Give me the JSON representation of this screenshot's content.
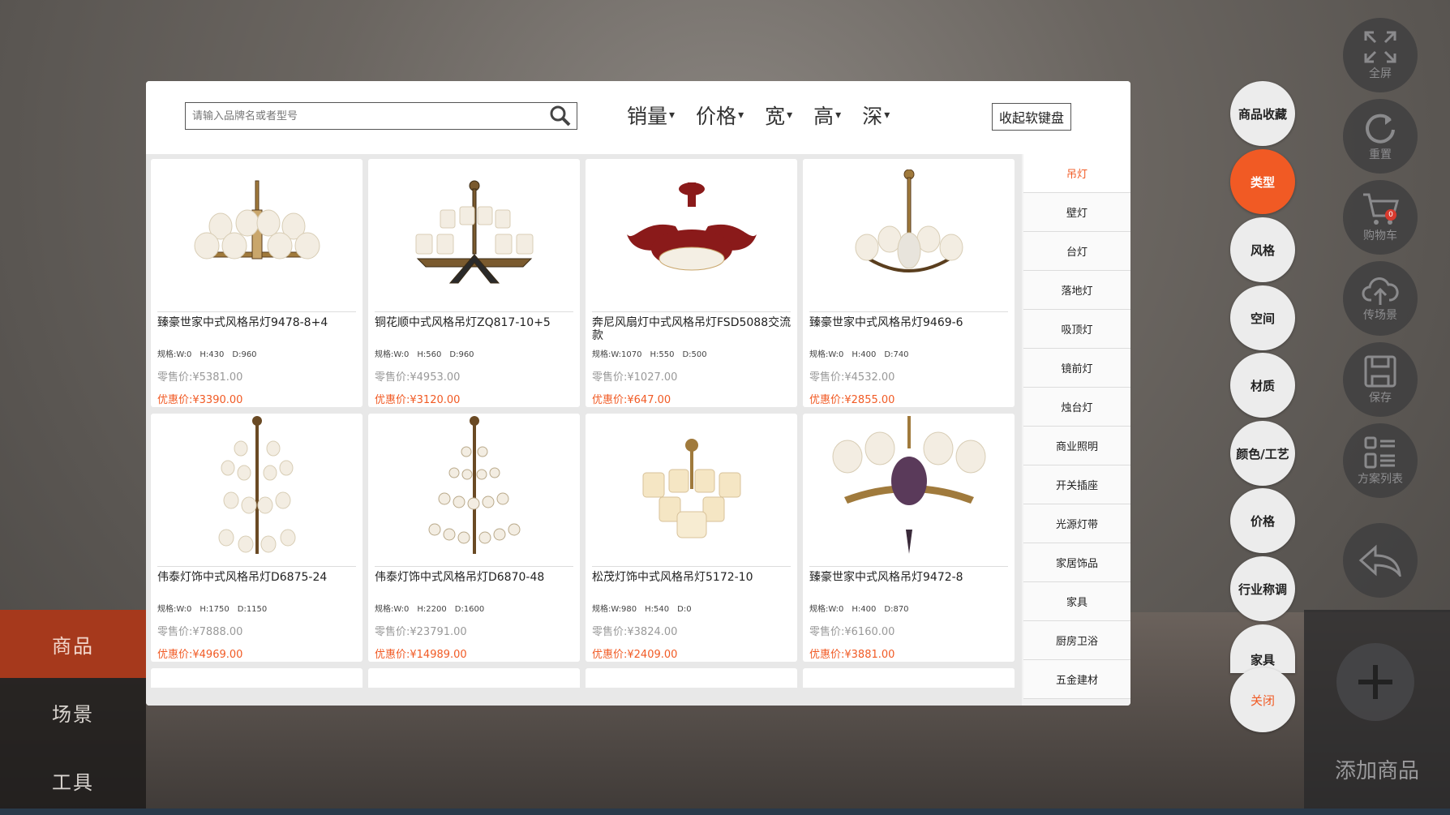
{
  "search": {
    "placeholder": "请输入品牌名或者型号"
  },
  "sorts": [
    {
      "label": "销量",
      "caret": "▾"
    },
    {
      "label": "价格",
      "caret": "▾"
    },
    {
      "label": "宽",
      "caret": "▾"
    },
    {
      "label": "高",
      "caret": "▾"
    },
    {
      "label": "深",
      "caret": "▾"
    }
  ],
  "keyboard_button": "收起软键盘",
  "products": [
    {
      "name": "臻豪世家中式风格吊灯9478-8+4",
      "w": "规格:W:0",
      "h": "H:430",
      "d": "D:960",
      "retail": "零售价:¥5381.00",
      "sale": "优惠价:¥3390.00"
    },
    {
      "name": "铜花顺中式风格吊灯ZQ817-10+5",
      "w": "规格:W:0",
      "h": "H:560",
      "d": "D:960",
      "retail": "零售价:¥4953.00",
      "sale": "优惠价:¥3120.00"
    },
    {
      "name": "奔尼风扇灯中式风格吊灯FSD5088交流款",
      "w": "规格:W:1070",
      "h": "H:550",
      "d": "D:500",
      "retail": "零售价:¥1027.00",
      "sale": "优惠价:¥647.00"
    },
    {
      "name": "臻豪世家中式风格吊灯9469-6",
      "w": "规格:W:0",
      "h": "H:400",
      "d": "D:740",
      "retail": "零售价:¥4532.00",
      "sale": "优惠价:¥2855.00"
    },
    {
      "name": "伟泰灯饰中式风格吊灯D6875-24",
      "w": "规格:W:0",
      "h": "H:1750",
      "d": "D:1150",
      "retail": "零售价:¥7888.00",
      "sale": "优惠价:¥4969.00"
    },
    {
      "name": "伟泰灯饰中式风格吊灯D6870-48",
      "w": "规格:W:0",
      "h": "H:2200",
      "d": "D:1600",
      "retail": "零售价:¥23791.00",
      "sale": "优惠价:¥14989.00"
    },
    {
      "name": "松茂灯饰中式风格吊灯5172-10",
      "w": "规格:W:980",
      "h": "H:540",
      "d": "D:0",
      "retail": "零售价:¥3824.00",
      "sale": "优惠价:¥2409.00"
    },
    {
      "name": "臻豪世家中式风格吊灯9472-8",
      "w": "规格:W:0",
      "h": "H:400",
      "d": "D:870",
      "retail": "零售价:¥6160.00",
      "sale": "优惠价:¥3881.00"
    }
  ],
  "categories": [
    "吊灯",
    "壁灯",
    "台灯",
    "落地灯",
    "吸顶灯",
    "镜前灯",
    "烛台灯",
    "商业照明",
    "开关插座",
    "光源灯带",
    "家居饰品",
    "家具",
    "厨房卫浴",
    "五金建材"
  ],
  "filters": [
    "商品收藏",
    "类型",
    "风格",
    "空间",
    "材质",
    "颜色/工艺",
    "价格",
    "行业称调",
    "家具",
    "关闭"
  ],
  "leftnav": [
    "商品",
    "场景",
    "工具"
  ],
  "toolbar": {
    "fullscreen": "全屏",
    "reset": "重置",
    "cart": "购物车",
    "cart_count": "0",
    "upload": "传场景",
    "save": "保存",
    "plan_list": "方案列表",
    "add_product": "添加商品"
  },
  "colors": {
    "accent": "#f15a24",
    "nav_active": "#a6391c"
  }
}
